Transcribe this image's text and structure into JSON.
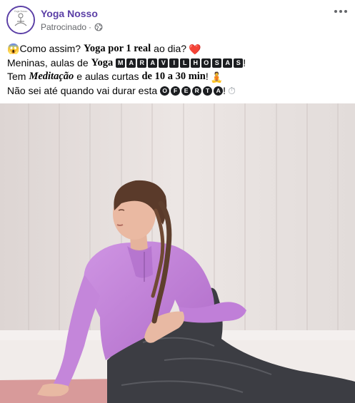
{
  "post": {
    "page_name": "Yoga Nosso",
    "sponsored_label": "Patrocinado",
    "separator": "·",
    "icons": {
      "privacy": "globe-icon",
      "more": "more-options-icon"
    },
    "lines": [
      {
        "emoji_start": "😱",
        "text_1": "Como assim?",
        "bold_1": "Yoga por 1 real",
        "text_2": "ao dia?",
        "emoji_end": "❤️"
      },
      {
        "text_1": "Meninas, aulas de",
        "bold_1": "Yoga",
        "boxed_letters": [
          "M",
          "A",
          "R",
          "A",
          "V",
          "I",
          "L",
          "H",
          "O",
          "S",
          "A",
          "S"
        ],
        "text_2": "!"
      },
      {
        "text_1": "Tem",
        "italic_bold": "Meditação",
        "text_2": "e aulas curtas",
        "bold_2": "de 10 a 30 min",
        "text_3": "!",
        "emoji_end": "🧘"
      },
      {
        "text_1": "Não sei até quando vai durar esta",
        "circled_letters": [
          "O",
          "F",
          "E",
          "R",
          "T",
          "A"
        ],
        "text_2": "!",
        "emoji_end": "⏱"
      }
    ],
    "image": {
      "subject": "woman-in-lilac-top-doing-seated-twist-yoga-pose",
      "colors": {
        "wall": "#e8e1df",
        "top": "#c07fd8",
        "leggings": "#3b3b40",
        "mat": "#d89a9a",
        "floor": "#f2eeed"
      }
    }
  }
}
